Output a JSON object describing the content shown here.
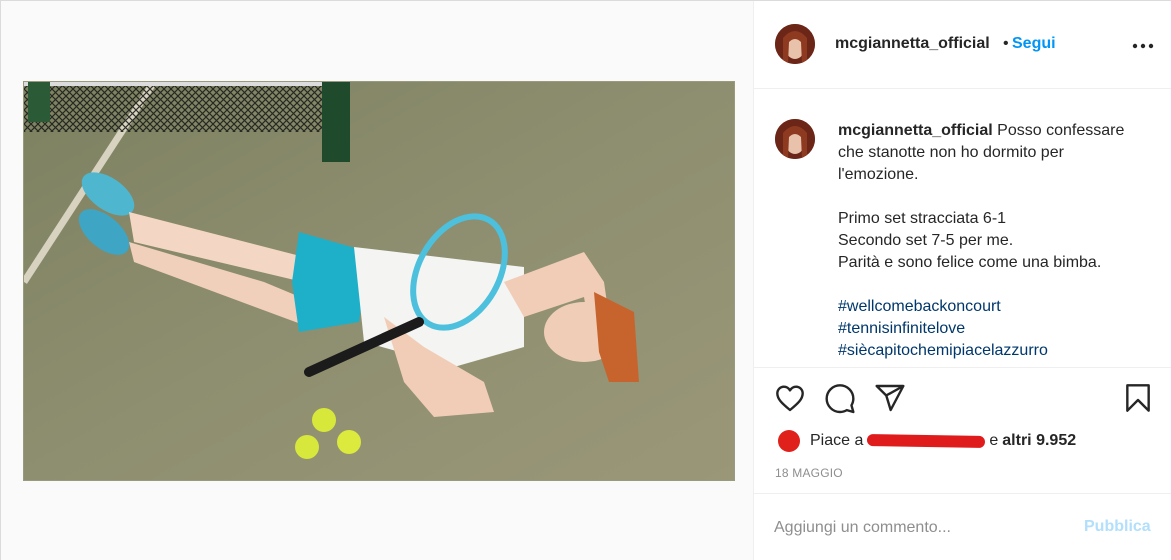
{
  "post": {
    "author": "mcgiannetta_official",
    "follow_separator": "•",
    "follow_label": "Segui",
    "more_label": "•••",
    "image_alt": "Tennis player lying on court with racket and balls"
  },
  "caption": {
    "username": "mcgiannetta_official",
    "lines": [
      "Posso confessare",
      "che stanotte non ho dormito per",
      "l'emozione."
    ],
    "score_lines": [
      "Primo set stracciata 6-1",
      "Secondo set 7-5 per me.",
      "Parità e sono felice come una bimba."
    ],
    "hashtags": [
      "#wellcomebackoncourt",
      "#tennisinfinitelove",
      "#sièc apitochemipiacelazzurro"
    ]
  },
  "actions": {
    "icons": [
      "heart-icon",
      "comment-icon",
      "share-icon",
      "bookmark-icon"
    ],
    "likes_prefix": "Piace a",
    "likes_suffix": "e",
    "likes_count_label": "altri 9.952",
    "date": "18 MAGGIO"
  },
  "comment": {
    "placeholder": "Aggiungi un commento...",
    "publish_label": "Pubblica"
  },
  "colors": {
    "link": "#0095f6",
    "hashtag": "#00376b",
    "publish_disabled": "#b2dffc",
    "court": "#8f8f6c",
    "shorts": "#1eb0c8"
  }
}
